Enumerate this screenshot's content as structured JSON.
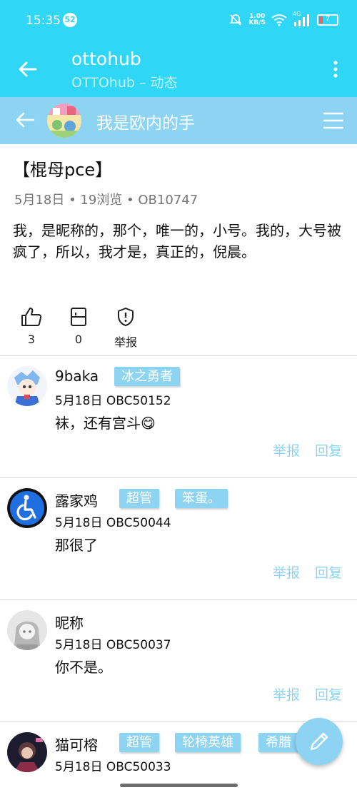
{
  "status_bar": {
    "time": "15:35",
    "notification_count": "52",
    "net_speed_value": "1.00",
    "net_speed_unit": "KB/S",
    "signal_label": "4G",
    "battery": "7"
  },
  "app_bar": {
    "title": "ottohub",
    "subtitle": "OTTOhub – 动态"
  },
  "sub_header": {
    "username": "我是欧内的手"
  },
  "post": {
    "title": "【棍母pce】",
    "meta": "5月18日 • 19浏览 • OB10747",
    "body": "我，是昵称的，那个，唯一的，小号。我的，大号被疯了，所以，我才是，真正的，倪晨。",
    "actions": {
      "like_count": "3",
      "save_count": "0",
      "report_label": "举报"
    }
  },
  "comments": [
    {
      "username": "9baka",
      "badges": [
        "冰之勇者"
      ],
      "meta": "5月18日 OBC50152",
      "text": "袜，还有宫斗😋",
      "report": "举报",
      "reply": "回复"
    },
    {
      "username": "露家鸡",
      "badges": [
        "超管",
        "笨蛋。"
      ],
      "meta": "5月18日 OBC50044",
      "text": "那很了",
      "report": "举报",
      "reply": "回复"
    },
    {
      "username": "昵称",
      "badges": [],
      "meta": "5月18日 OBC50037",
      "text": "你不是。",
      "report": "举报",
      "reply": "回复"
    },
    {
      "username": "猫可榕",
      "badges": [
        "超管",
        "轮椅英雄",
        "希腊"
      ],
      "meta": "5月18日 OBC50033"
    }
  ],
  "colors": {
    "app_bar": "#30d6f6",
    "accent": "#8cd4f2",
    "text": "#111111",
    "muted": "#777777"
  },
  "icons": {
    "back": "arrow-left-icon",
    "more": "more-vert-icon",
    "menu": "hamburger-menu-icon",
    "like": "thumb-up-icon",
    "save": "bookmark-icon",
    "report": "shield-alert-icon",
    "compose": "pencil-icon"
  }
}
